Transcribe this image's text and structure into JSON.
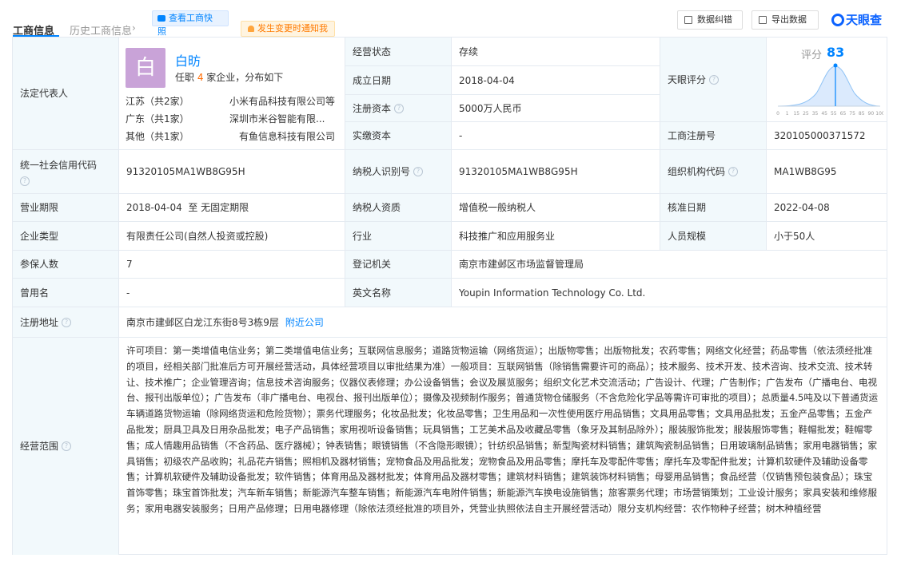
{
  "header": {
    "tab_active": "工商信息",
    "tab_history": "历史工商信息",
    "snapshot_line1": "查看工商快",
    "snapshot_line2": "照",
    "notify": "发生变更时通知我",
    "btn_correct": "数据纠错",
    "btn_export": "导出数据",
    "logo": "天眼查"
  },
  "legal": {
    "label": "法定代表人",
    "avatar": "白",
    "name": "白昉",
    "desc_prefix": "任职 ",
    "desc_count": "4",
    "desc_suffix": " 家企业，分布如下",
    "regions": [
      {
        "prov": "江苏（共2家）",
        "company": "小米有品科技有限公司等"
      },
      {
        "prov": "广东（共1家）",
        "company": "深圳市米谷智能有限..."
      },
      {
        "prov": "其他（共1家）",
        "company": "有鱼信息科技有限公司"
      }
    ]
  },
  "status": {
    "label": "经营状态",
    "value": "存续"
  },
  "established": {
    "label": "成立日期",
    "value": "2018-04-04"
  },
  "capital": {
    "label": "注册资本",
    "value": "5000万人民币"
  },
  "paid_capital": {
    "label": "实缴资本",
    "value": "-"
  },
  "score": {
    "label": "天眼评分",
    "title": "评分",
    "value": "83",
    "ticks": [
      "0",
      "1",
      "15",
      "25",
      "35",
      "45",
      "55",
      "65",
      "75",
      "85",
      "90",
      "100"
    ]
  },
  "reg_no": {
    "label": "工商注册号",
    "value": "320105000371572"
  },
  "credit_code": {
    "label": "统一社会信用代码",
    "value": "91320105MA1WB8G95H"
  },
  "taxpayer_id": {
    "label": "纳税人识别号",
    "value": "91320105MA1WB8G95H"
  },
  "org_code": {
    "label": "组织机构代码",
    "value": "MA1WB8G95"
  },
  "term": {
    "label": "营业期限",
    "value": "2018-04-04  至 无固定期限"
  },
  "taxpayer_qual": {
    "label": "纳税人资质",
    "value": "增值税一般纳税人"
  },
  "approve_date": {
    "label": "核准日期",
    "value": "2022-04-08"
  },
  "company_type": {
    "label": "企业类型",
    "value": "有限责任公司(自然人投资或控股)"
  },
  "industry": {
    "label": "行业",
    "value": "科技推广和应用服务业"
  },
  "staff_size": {
    "label": "人员规模",
    "value": "小于50人"
  },
  "insured": {
    "label": "参保人数",
    "value": "7"
  },
  "reg_authority": {
    "label": "登记机关",
    "value": "南京市建邺区市场监督管理局"
  },
  "former_name": {
    "label": "曾用名",
    "value": "-"
  },
  "english_name": {
    "label": "英文名称",
    "value": "Youpin Information Technology Co. Ltd."
  },
  "address": {
    "label": "注册地址",
    "value": "南京市建邺区白龙江东街8号3栋9层",
    "link": "附近公司"
  },
  "scope": {
    "label": "经营范围",
    "value": "许可项目：第一类增值电信业务；第二类增值电信业务；互联网信息服务；道路货物运输（网络货运）；出版物零售；出版物批发；农药零售；网络文化经营；药品零售（依法须经批准的项目，经相关部门批准后方可开展经营活动，具体经营项目以审批结果为准）一般项目：互联网销售（除销售需要许可的商品）；技术服务、技术开发、技术咨询、技术交流、技术转让、技术推广；企业管理咨询；信息技术咨询服务；仪器仪表修理；办公设备销售；会议及展览服务；组织文化艺术交流活动；广告设计、代理；广告制作；广告发布（广播电台、电视台、报刊出版单位）；广告发布（非广播电台、电视台、报刊出版单位）；摄像及视频制作服务；普通货物仓储服务（不含危险化学品等需许可审批的项目）；总质量4.5吨及以下普通货运车辆道路货物运输（除网络货运和危险货物）；票务代理服务；化妆品批发；化妆品零售；卫生用品和一次性使用医疗用品销售；文具用品零售；文具用品批发；五金产品零售；五金产品批发；厨具卫具及日用杂品批发；电子产品销售；家用视听设备销售；玩具销售；工艺美术品及收藏品零售（象牙及其制品除外）；服装服饰批发；服装服饰零售；鞋帽批发；鞋帽零售；成人情趣用品销售（不含药品、医疗器械）；钟表销售；眼镜销售（不含隐形眼镜）；针纺织品销售；新型陶瓷材料销售；建筑陶瓷制品销售；日用玻璃制品销售；家用电器销售；家具销售；初级农产品收购；礼品花卉销售；照相机及器材销售；宠物食品及用品批发；宠物食品及用品零售；摩托车及零配件零售；摩托车及零配件批发；计算机软硬件及辅助设备零售；计算机软硬件及辅助设备批发；软件销售；体育用品及器材批发；体育用品及器材零售；建筑材料销售；建筑装饰材料销售；母婴用品销售；食品经营（仅销售预包装食品）；珠宝首饰零售；珠宝首饰批发；汽车新车销售；新能源汽车整车销售；新能源汽车电附件销售；新能源汽车换电设施销售；旅客票务代理；市场营销策划；工业设计服务；家具安装和维修服务；家用电器安装服务；日用产品修理；日用电器修理（除依法须经批准的项目外，凭营业执照依法自主开展经营活动）限分支机构经营：农作物种子经营；树木种植经营"
  },
  "colors": {
    "accent": "#0084ff",
    "label_bg": "#f2f9fc",
    "border": "#e4eaf1",
    "warn": "#ff7a00",
    "avatar": "#c9a3d8"
  }
}
